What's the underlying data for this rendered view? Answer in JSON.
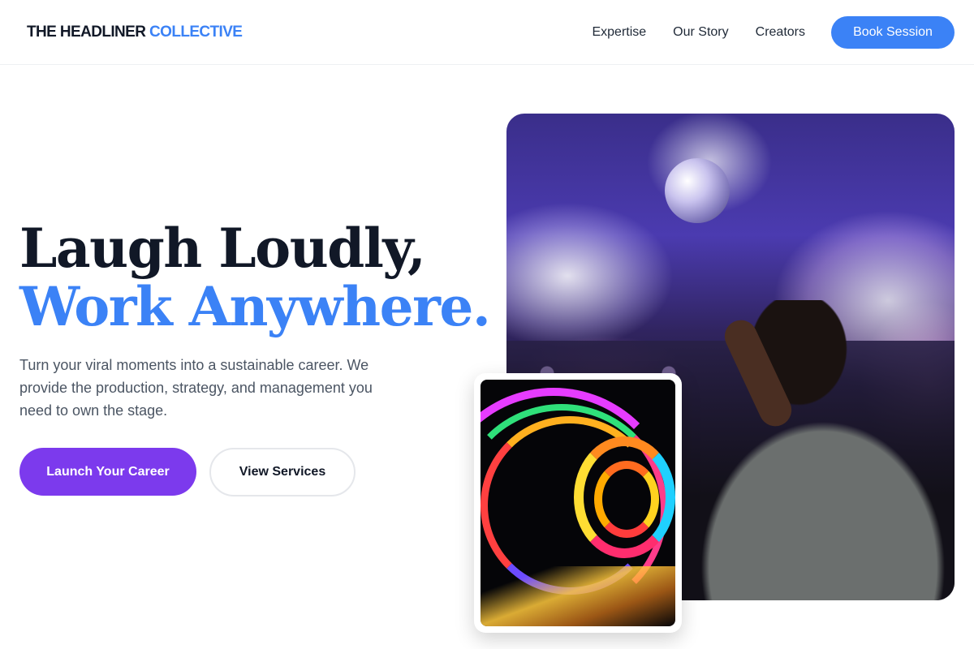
{
  "header": {
    "logo_main": "THE HEADLINER",
    "logo_accent": "COLLECTIVE",
    "nav": [
      {
        "label": "Expertise"
      },
      {
        "label": "Our Story"
      },
      {
        "label": "Creators"
      }
    ],
    "cta_label": "Book Session"
  },
  "hero": {
    "title_line1": "Laugh Loudly,",
    "title_line2": "Work Anywhere.",
    "subtitle": "Turn your viral moments into a sustainable career. We provide the production, strategy, and management you need to own the stage.",
    "primary_button": "Launch Your Career",
    "secondary_button": "View Services"
  },
  "colors": {
    "accent_blue": "#3b82f6",
    "accent_purple": "#7c3aed",
    "heading_dark": "#111827",
    "body_gray": "#4b5563"
  }
}
